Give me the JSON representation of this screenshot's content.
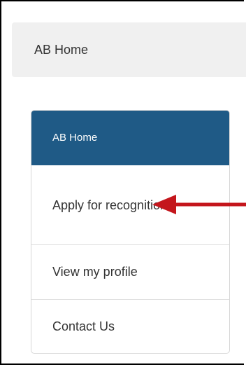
{
  "breadcrumb": {
    "current": "AB Home"
  },
  "nav": {
    "items": [
      {
        "label": "AB Home"
      },
      {
        "label": "Apply for recognition"
      },
      {
        "label": "View my profile"
      },
      {
        "label": "Contact Us"
      }
    ]
  },
  "colors": {
    "active_bg": "#1f5a86",
    "breadcrumb_bg": "#f0f0f0",
    "arrow": "#c4161c"
  },
  "annotation": {
    "arrow_icon": "red-arrow-left-icon"
  }
}
